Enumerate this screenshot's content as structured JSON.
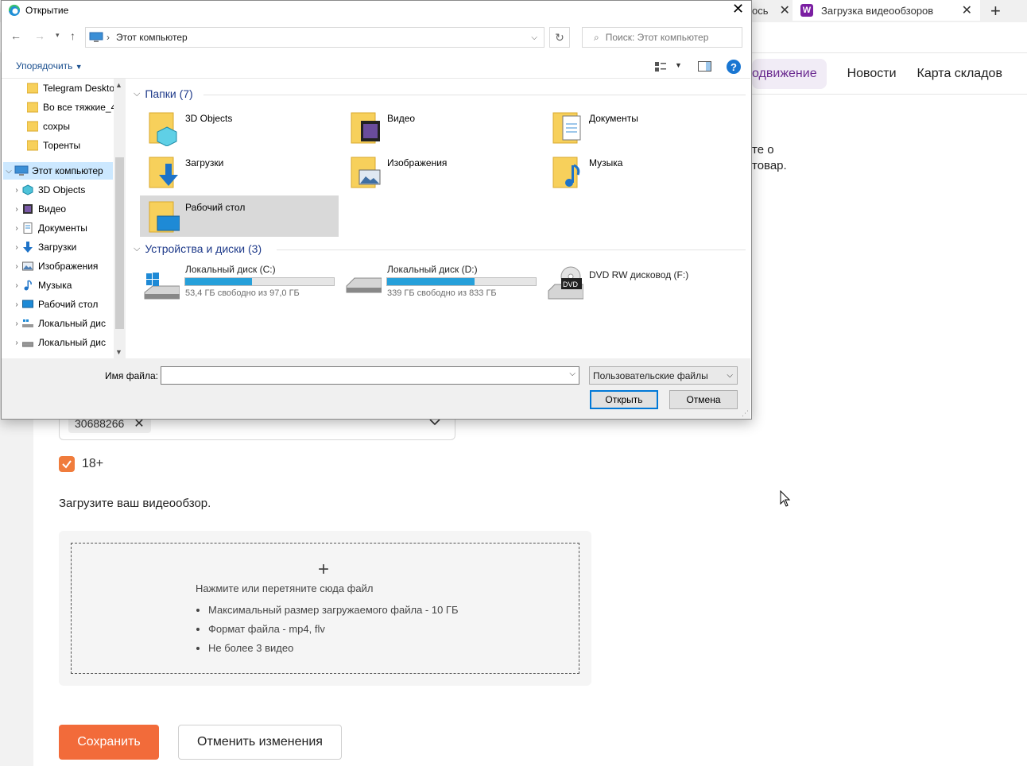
{
  "browser": {
    "tabs": [
      {
        "label": "ось",
        "close": "✕"
      },
      {
        "label": "Загрузка видеообзоров",
        "close": "✕",
        "favicon": "W"
      }
    ],
    "new_tab": "+"
  },
  "page": {
    "nav": [
      "одвижение",
      "Новости",
      "Карта складов"
    ],
    "partial_text": [
      "те о",
      "товар."
    ],
    "tag_chip": "30688266",
    "checkbox_label": "18+",
    "upload_title": "Загрузите ваш видеообзор.",
    "drop_hint": "Нажмите или перетяните сюда файл",
    "drop_rules": [
      "Максимальный размер загружаемого файла - 10 ГБ",
      "Формат файла - mp4, flv",
      "Не более 3 видео"
    ],
    "save_label": "Сохранить",
    "cancel_label": "Отменить изменения",
    "accent": "#f26b3a"
  },
  "dialog": {
    "title": "Открытие",
    "address": "Этот компьютер",
    "search_placeholder": "Поиск: Этот компьютер",
    "organize": "Упорядочить",
    "tree": [
      {
        "label": "Telegram Deskto",
        "icon": "folder-icon"
      },
      {
        "label": "Во все тяжкие_4",
        "icon": "folder-icon"
      },
      {
        "label": "сохры",
        "icon": "folder-icon"
      },
      {
        "label": "Торенты",
        "icon": "folder-icon"
      },
      {
        "label": "Этот компьютер",
        "icon": "computer-icon",
        "selected": true
      },
      {
        "label": "3D Objects",
        "icon": "3d-objects-icon"
      },
      {
        "label": "Видео",
        "icon": "video-icon"
      },
      {
        "label": "Документы",
        "icon": "documents-icon"
      },
      {
        "label": "Загрузки",
        "icon": "downloads-icon"
      },
      {
        "label": "Изображения",
        "icon": "pictures-icon"
      },
      {
        "label": "Музыка",
        "icon": "music-icon"
      },
      {
        "label": "Рабочий стол",
        "icon": "desktop-icon"
      },
      {
        "label": "Локальный дис",
        "icon": "drive-icon"
      },
      {
        "label": "Локальный дис",
        "icon": "drive-icon"
      }
    ],
    "folders_header": "Папки (7)",
    "folders": [
      "3D Objects",
      "Видео",
      "Документы",
      "Загрузки",
      "Изображения",
      "Музыка",
      "Рабочий стол"
    ],
    "drives_header": "Устройства и диски (3)",
    "drives": [
      {
        "name": "Локальный диск (C:)",
        "free": "53,4 ГБ свободно из 97,0 ГБ",
        "used_fraction": 0.45
      },
      {
        "name": "Локальный диск (D:)",
        "free": "339 ГБ свободно из 833 ГБ",
        "used_fraction": 0.59
      },
      {
        "name": "DVD RW дисковод (F:)"
      }
    ],
    "filename_label": "Имя файла:",
    "filename_value": "",
    "file_type": "Пользовательские файлы",
    "open_label": "Открыть",
    "cancel_label": "Отмена",
    "dvd_label": "DVD"
  }
}
